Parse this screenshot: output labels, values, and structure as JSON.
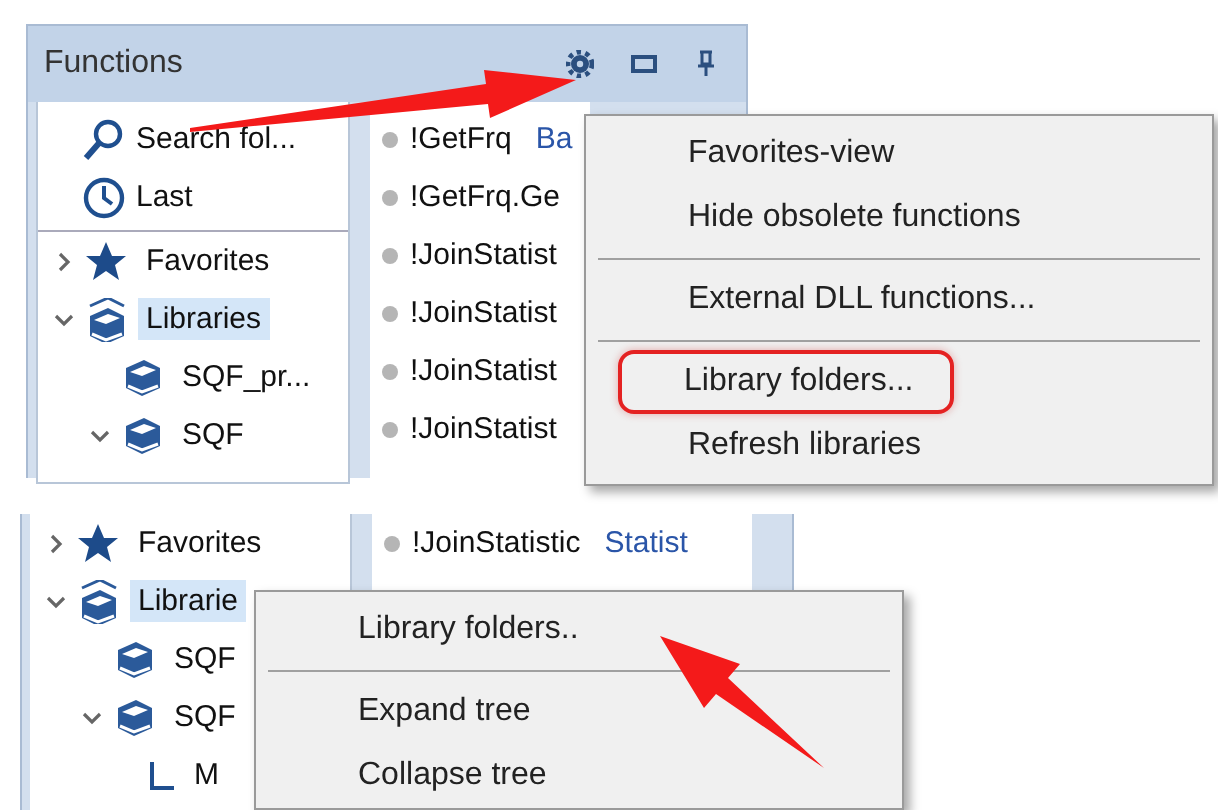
{
  "top_view": {
    "panel": {
      "title": "Functions",
      "shortcuts": [
        {
          "label": "Search fol...",
          "kind": "search"
        },
        {
          "label": "Last",
          "kind": "clock"
        }
      ],
      "tree": [
        {
          "label": "Favorites",
          "kind": "star",
          "expanded": false,
          "selected": false
        },
        {
          "label": "Libraries",
          "kind": "books",
          "expanded": true,
          "selected": true,
          "children": [
            {
              "label": "SQF_pr...",
              "kind": "book",
              "selected": false
            },
            {
              "label": "SQF",
              "kind": "book",
              "expanded": true,
              "selected": false
            }
          ]
        }
      ],
      "functions": [
        {
          "name": "!GetFrq",
          "category": "Ba"
        },
        {
          "name": "!GetFrq.Ge"
        },
        {
          "name": "!JoinStatist"
        },
        {
          "name": "!JoinStatist"
        },
        {
          "name": "!JoinStatist"
        },
        {
          "name": "!JoinStatist"
        }
      ]
    },
    "menu": [
      {
        "label": "Favorites-view",
        "separator_before": false,
        "outlined": false
      },
      {
        "label": "Hide obsolete functions",
        "separator_before": false,
        "outlined": false
      },
      {
        "label": "External DLL functions...",
        "separator_before": true,
        "outlined": false
      },
      {
        "label": "Library folders...",
        "separator_before": true,
        "outlined": true
      },
      {
        "label": "Refresh libraries",
        "separator_before": false,
        "outlined": false
      }
    ]
  },
  "bottom_view": {
    "panel": {
      "tree": [
        {
          "label": "Favorites",
          "kind": "star",
          "expanded": false,
          "selected": false
        },
        {
          "label": "Librarie",
          "kind": "books",
          "expanded": true,
          "selected": true,
          "children": [
            {
              "label": "SQF",
              "kind": "book",
              "selected": false
            },
            {
              "label": "SQF",
              "kind": "book",
              "expanded": true,
              "selected": false,
              "children": [
                {
                  "label": "M",
                  "kind": "leaf",
                  "selected": false
                }
              ]
            }
          ]
        }
      ],
      "functions": [
        {
          "name": "!JoinStatistic",
          "category": "Statist"
        }
      ]
    },
    "menu": [
      {
        "label": "Library folders..",
        "separator_before": false,
        "outlined": false
      },
      {
        "label": "Expand tree",
        "separator_before": true,
        "outlined": false
      },
      {
        "label": "Collapse tree",
        "separator_before": false,
        "outlined": false
      }
    ]
  }
}
